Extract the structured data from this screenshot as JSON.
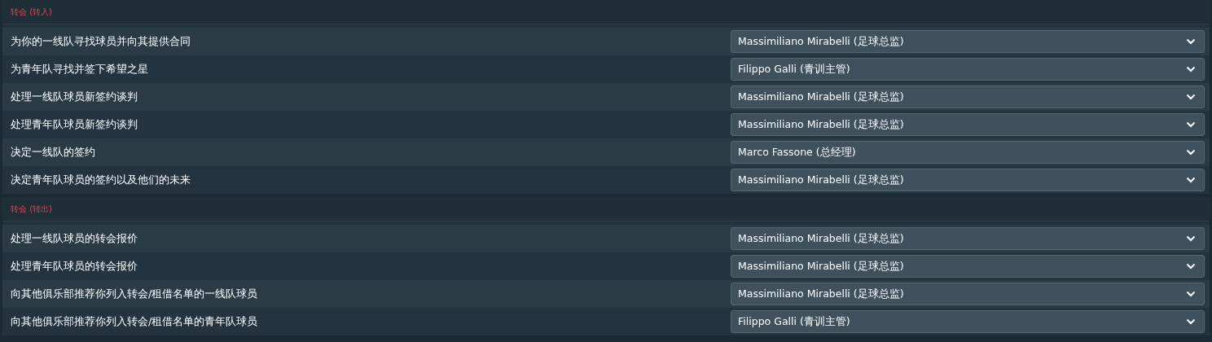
{
  "sections": [
    {
      "title": "转会 (转入)",
      "rows": [
        {
          "label": "为你的一线队寻找球员并向其提供合同",
          "value": "Massimiliano Mirabelli (足球总监)"
        },
        {
          "label": "为青年队寻找并签下希望之星",
          "value": "Filippo Galli (青训主管)"
        },
        {
          "label": "处理一线队球员新签约谈判",
          "value": "Massimiliano Mirabelli (足球总监)"
        },
        {
          "label": "处理青年队球员新签约谈判",
          "value": "Massimiliano Mirabelli (足球总监)"
        },
        {
          "label": "决定一线队的签约",
          "value": "Marco Fassone (总经理)"
        },
        {
          "label": "决定青年队球员的签约以及他们的未来",
          "value": "Massimiliano Mirabelli (足球总监)"
        }
      ]
    },
    {
      "title": "转会 (转出)",
      "rows": [
        {
          "label": "处理一线队球员的转会报价",
          "value": "Massimiliano Mirabelli (足球总监)"
        },
        {
          "label": "处理青年队球员的转会报价",
          "value": "Massimiliano Mirabelli (足球总监)"
        },
        {
          "label": "向其他俱乐部推荐你列入转会/租借名单的一线队球员",
          "value": "Massimiliano Mirabelli (足球总监)"
        },
        {
          "label": "向其他俱乐部推荐你列入转会/租借名单的青年队球员",
          "value": "Filippo Galli (青训主管)"
        }
      ]
    }
  ]
}
